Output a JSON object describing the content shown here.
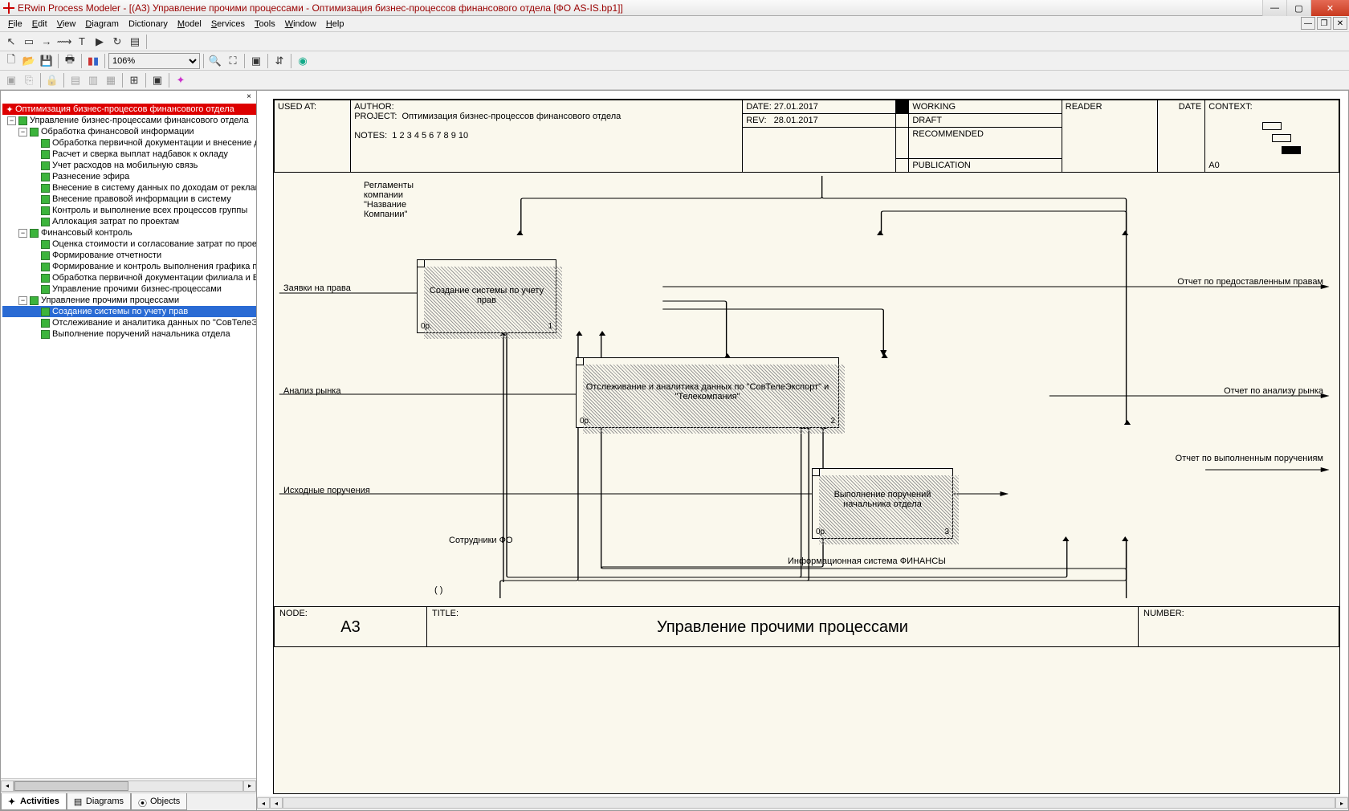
{
  "window": {
    "title": "ERwin Process Modeler - [(A3) Управление прочими процессами - Оптимизация бизнес-процессов финансового отдела  [ФО AS-IS.bp1]]"
  },
  "menu": {
    "file": "File",
    "edit": "Edit",
    "view": "View",
    "diagram": "Diagram",
    "dictionary": "Dictionary",
    "model": "Model",
    "services": "Services",
    "tools": "Tools",
    "window": "Window",
    "help": "Help"
  },
  "zoom": "106%",
  "sidebar_tabs": {
    "activities": "Activities",
    "diagrams": "Diagrams",
    "objects": "Objects"
  },
  "tree": {
    "root": "Оптимизация бизнес-процессов финансового отдела",
    "n1": "Управление бизнес-процессами финансового отдела",
    "n11": "Обработка финансовой информации",
    "n111": "Обработка первичной документации и внесение данных",
    "n112": "Расчет и сверка выплат надбавок к окладу",
    "n113": "Учет расходов на мобильную связь",
    "n114": "Разнесение эфира",
    "n115": "Внесение в систему данных по доходам от рекламы",
    "n116": "Внесение правовой информации в систему",
    "n117": "Контроль и выполнение всех процессов группы",
    "n118": "Аллокация затрат по проектам",
    "n12": "Финансовый контроль",
    "n121": "Оценка стоимости и согласование затрат по проектам",
    "n122": "Формирование отчетности",
    "n123": "Формирование и контроль выполнения графика плате",
    "n124": "Обработка первичной документации филиала и ВГТРК",
    "n125": "Управление прочими бизнес-процессами",
    "n13": "Управление прочими процессами",
    "n131": "Создание системы по учету прав",
    "n132": "Отслеживание и аналитика данных по \"СовТелеЭкспор",
    "n133": "Выполнение поручений начальника отдела"
  },
  "header": {
    "used_at": "USED AT:",
    "author": "AUTHOR:",
    "project": "PROJECT:",
    "project_val": "Оптимизация бизнес-процессов финансового отдела",
    "notes": "NOTES:",
    "notes_val": "1  2  3  4  5  6  7  8  9  10",
    "date": "DATE:",
    "date_val": "27.01.2017",
    "rev": "REV:",
    "rev_val": "28.01.2017",
    "working": "WORKING",
    "draft": "DRAFT",
    "recommended": "RECOMMENDED",
    "publication": "PUBLICATION",
    "reader": "READER",
    "hdate": "DATE",
    "context": "CONTEXT:",
    "context_val": "A0"
  },
  "diagram": {
    "control": "Регламенты компании \"Название Компании\"",
    "in1": "Заявки на права",
    "out1": "Отчет по предоставленным правам",
    "in2": "Анализ рынка",
    "out2": "Отчет по анализу рынка",
    "in3": "Исходные поручения",
    "out3": "Отчет по выполненным поручениям",
    "mech1": "Сотрудники ФО",
    "mech2": "Информационная система ФИНАНСЫ",
    "mech3": "( )",
    "box1": "Создание системы по учету прав",
    "box2": "Отслеживание и аналитика данных по \"СовТелеЭкспорт\" и \"Телекомпания\"",
    "box3": "Выполнение поручений начальника отдела",
    "cost": "0р.",
    "n1": "1",
    "n2": "2",
    "n3": "3"
  },
  "footer": {
    "node": "NODE:",
    "node_val": "A3",
    "title": "TITLE:",
    "title_val": "Управление прочими процессами",
    "number": "NUMBER:"
  }
}
